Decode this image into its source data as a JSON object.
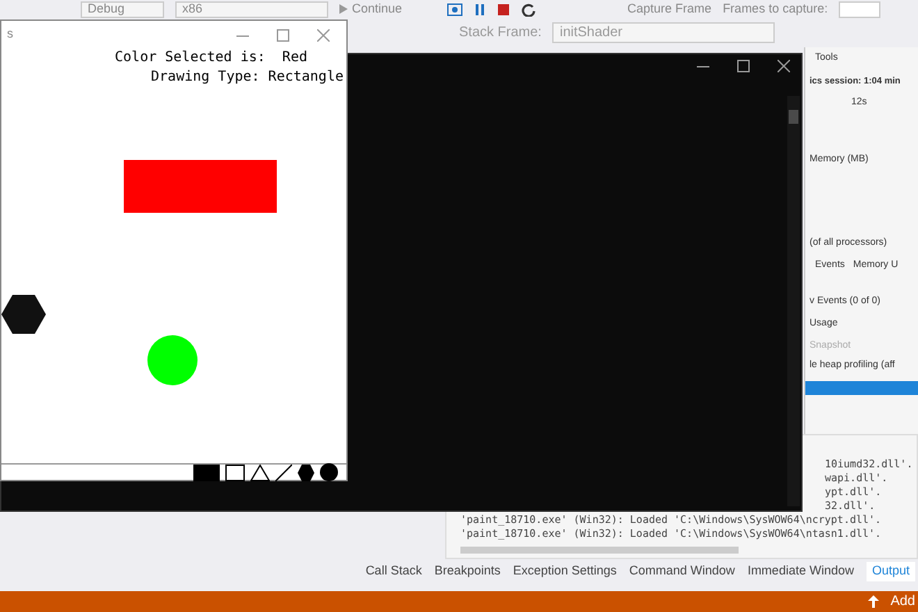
{
  "toolbar": {
    "configuration": "Debug",
    "platform": "x86",
    "continue": "Continue",
    "capture": "Capture Frame",
    "frames_label": "Frames to capture:"
  },
  "stack_toolbar": {
    "label": "Stack Frame:",
    "value": "initShader"
  },
  "diagnostics": {
    "title": "Tools",
    "session": "ics session: 1:04 min",
    "tick": "12s",
    "memory": "Memory (MB)",
    "cpu": "(of all processors)",
    "tabs": [
      "Events",
      "Memory U"
    ],
    "events": "v Events (0 of 0)",
    "usage": "Usage",
    "snapshot": "Snapshot",
    "heap": "le heap profiling (aff"
  },
  "output": {
    "lines": [
      {
        "kind": "partial",
        "text": "10iumd32.dll'."
      },
      {
        "kind": "partial",
        "text": "wapi.dll'."
      },
      {
        "kind": "partial",
        "text": "ypt.dll'."
      },
      {
        "kind": "partial",
        "text": "32.dll'."
      },
      {
        "kind": "full",
        "text": "'paint_18710.exe' (Win32): Loaded 'C:\\Windows\\SysWOW64\\ncrypt.dll'."
      },
      {
        "kind": "full",
        "text": "'paint_18710.exe' (Win32): Loaded 'C:\\Windows\\SysWOW64\\ntasn1.dll'."
      }
    ]
  },
  "bottom_tabs": [
    {
      "label": "Call Stack",
      "selected": false
    },
    {
      "label": "Breakpoints",
      "selected": false
    },
    {
      "label": "Exception Settings",
      "selected": false
    },
    {
      "label": "Command Window",
      "selected": false
    },
    {
      "label": "Immediate Window",
      "selected": false
    },
    {
      "label": "Output",
      "selected": true
    }
  ],
  "status_bar": {
    "action": "Add"
  },
  "paint_window": {
    "title": "s",
    "color_line": "Color Selected is:  Red",
    "type_line": "Drawing Type: Rectangle"
  }
}
